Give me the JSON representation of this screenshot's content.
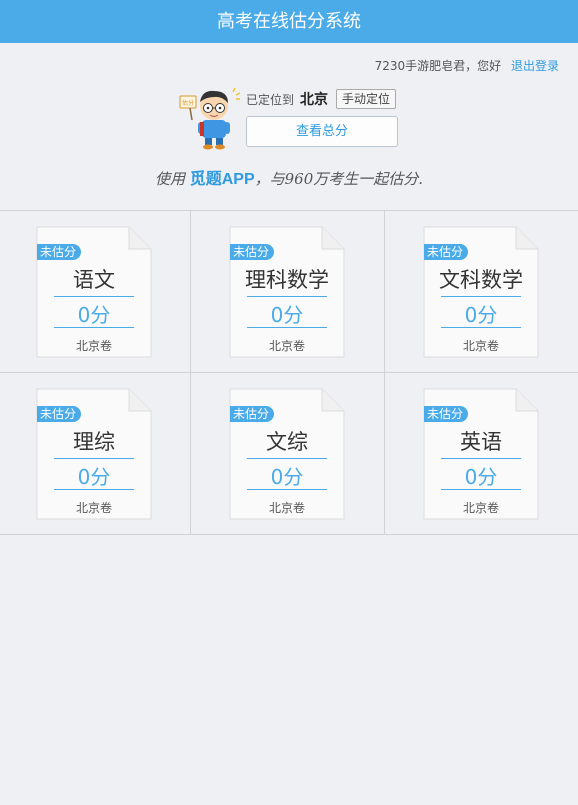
{
  "header": {
    "title": "高考在线估分系统"
  },
  "user": {
    "greeting": "7230手游肥皂君，您好",
    "logout_label": "退出登录"
  },
  "location": {
    "prefix": "已定位到",
    "city": "北京",
    "manual_button": "手动定位"
  },
  "total_button": "查看总分",
  "mascot": {
    "sign_text": "估分"
  },
  "slogan": {
    "before": "使用 ",
    "brand": "觅题APP",
    "after": "，与960万考生一起估分."
  },
  "colors": {
    "accent": "#4aabe8",
    "background": "#eff0f4"
  },
  "subjects": [
    {
      "tag": "未估分",
      "name": "语文",
      "score": "0分",
      "paper": "北京卷"
    },
    {
      "tag": "未估分",
      "name": "理科数学",
      "score": "0分",
      "paper": "北京卷"
    },
    {
      "tag": "未估分",
      "name": "文科数学",
      "score": "0分",
      "paper": "北京卷"
    },
    {
      "tag": "未估分",
      "name": "理综",
      "score": "0分",
      "paper": "北京卷"
    },
    {
      "tag": "未估分",
      "name": "文综",
      "score": "0分",
      "paper": "北京卷"
    },
    {
      "tag": "未估分",
      "name": "英语",
      "score": "0分",
      "paper": "北京卷"
    }
  ]
}
